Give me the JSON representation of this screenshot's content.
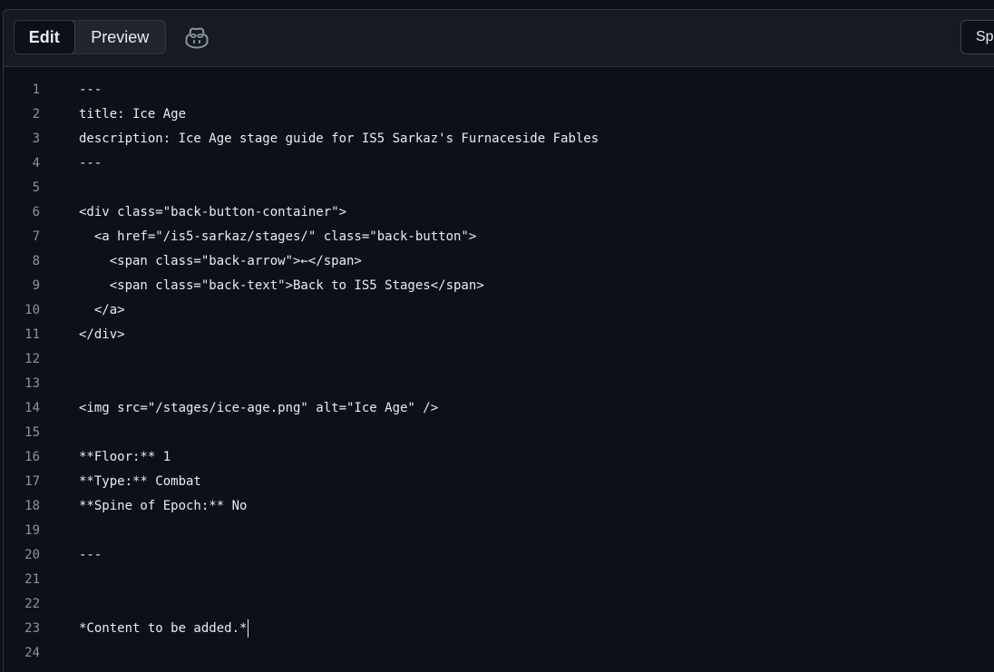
{
  "toolbar": {
    "tabs": [
      {
        "label": "Edit",
        "active": true
      },
      {
        "label": "Preview",
        "active": false
      }
    ],
    "copilot_icon": "copilot-icon",
    "right_button_label": "Spa"
  },
  "editor": {
    "cursor_line": 23,
    "lines": [
      {
        "number": "1",
        "text": "---"
      },
      {
        "number": "2",
        "text": "title: Ice Age"
      },
      {
        "number": "3",
        "text": "description: Ice Age stage guide for IS5 Sarkaz's Furnaceside Fables"
      },
      {
        "number": "4",
        "text": "---"
      },
      {
        "number": "5",
        "text": ""
      },
      {
        "number": "6",
        "text": "<div class=\"back-button-container\">"
      },
      {
        "number": "7",
        "text": "  <a href=\"/is5-sarkaz/stages/\" class=\"back-button\">"
      },
      {
        "number": "8",
        "text": "    <span class=\"back-arrow\">←</span>"
      },
      {
        "number": "9",
        "text": "    <span class=\"back-text\">Back to IS5 Stages</span>"
      },
      {
        "number": "10",
        "text": "  </a>"
      },
      {
        "number": "11",
        "text": "</div>"
      },
      {
        "number": "12",
        "text": ""
      },
      {
        "number": "13",
        "text": ""
      },
      {
        "number": "14",
        "text": "<img src=\"/stages/ice-age.png\" alt=\"Ice Age\" />"
      },
      {
        "number": "15",
        "text": ""
      },
      {
        "number": "16",
        "text": "**Floor:** 1"
      },
      {
        "number": "17",
        "text": "**Type:** Combat"
      },
      {
        "number": "18",
        "text": "**Spine of Epoch:** No"
      },
      {
        "number": "19",
        "text": ""
      },
      {
        "number": "20",
        "text": "---"
      },
      {
        "number": "21",
        "text": ""
      },
      {
        "number": "22",
        "text": ""
      },
      {
        "number": "23",
        "text": "*Content to be added.*"
      },
      {
        "number": "24",
        "text": ""
      }
    ]
  }
}
